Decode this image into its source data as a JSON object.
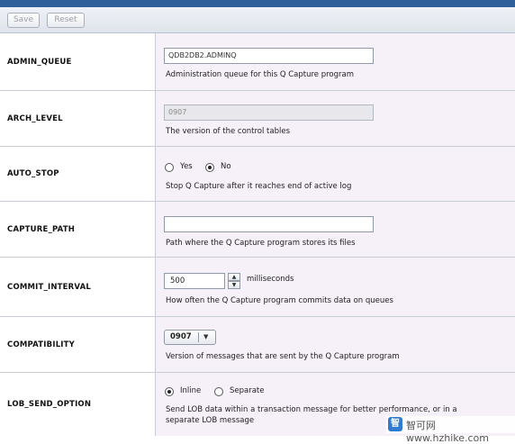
{
  "toolbar": {
    "save_label": "Save",
    "reset_label": "Reset"
  },
  "rows": {
    "admin_queue": {
      "label": "ADMIN_QUEUE",
      "value": "QDB2DB2.ADMINQ",
      "description": "Administration queue for this Q Capture program"
    },
    "arch_level": {
      "label": "ARCH_LEVEL",
      "value": "0907",
      "description": "The version of the control tables"
    },
    "auto_stop": {
      "label": "AUTO_STOP",
      "option_yes": "Yes",
      "option_no": "No",
      "selected": "No",
      "description": "Stop Q Capture after it reaches end of active log"
    },
    "capture_path": {
      "label": "CAPTURE_PATH",
      "value": "",
      "description": "Path where the Q Capture program stores its files"
    },
    "commit_interval": {
      "label": "COMMIT_INTERVAL",
      "value": "500",
      "unit": "milliseconds",
      "description": "How often the Q Capture program commits data on queues"
    },
    "compatibility": {
      "label": "COMPATIBILITY",
      "value": "0907",
      "description": "Version of messages that are sent by the Q Capture program"
    },
    "lob_send_option": {
      "label": "LOB_SEND_OPTION",
      "option_inline": "Inline",
      "option_separate": "Separate",
      "selected": "Inline",
      "description_line1": "Send LOB data within a transaction message for better performance, or in a",
      "description_line2": "separate LOB message"
    }
  },
  "watermark": {
    "logo_char": "智",
    "text": "智可网 www.hzhike.com"
  },
  "colors": {
    "value_bg": "#f6f0f8",
    "title_bar": "#2f5f9a",
    "grid_line": "#c8ccd4"
  }
}
